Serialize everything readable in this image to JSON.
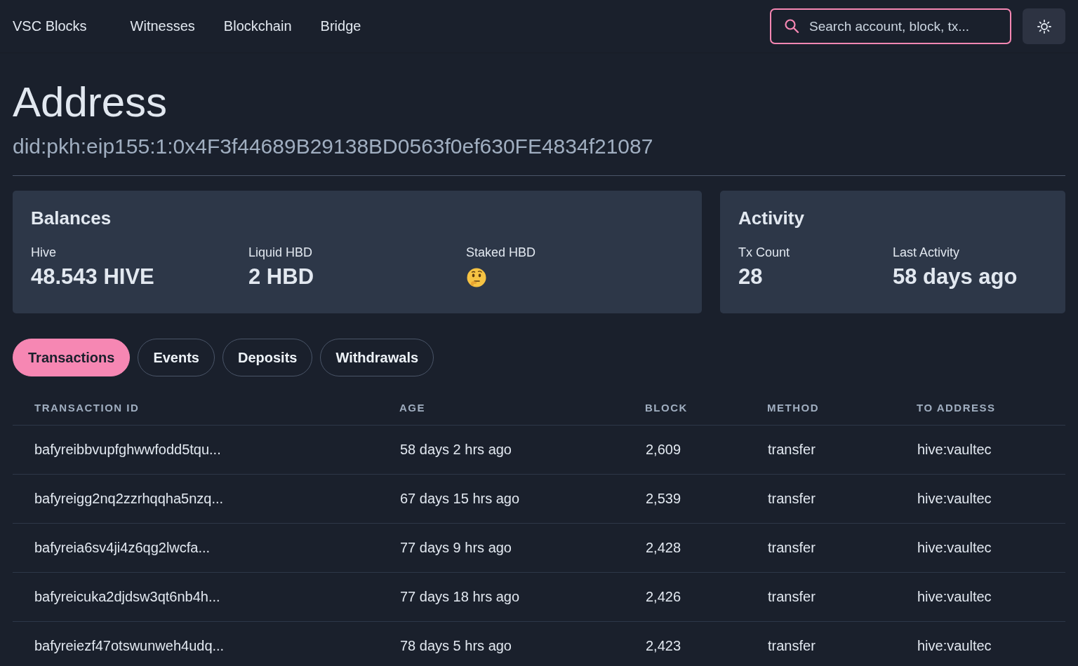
{
  "nav": {
    "brand": "VSC Blocks",
    "links": [
      "Witnesses",
      "Blockchain",
      "Bridge"
    ],
    "search": {
      "placeholder": "Search account, block, tx..."
    }
  },
  "page": {
    "title": "Address",
    "address": "did:pkh:eip155:1:0x4F3f44689B29138BD0563f0ef630FE4834f21087"
  },
  "balances": {
    "title": "Balances",
    "items": [
      {
        "label": "Hive",
        "kind": "value",
        "value": "48.543 HIVE"
      },
      {
        "label": "Liquid HBD",
        "kind": "value",
        "value": "2 HBD"
      },
      {
        "label": "Staked HBD",
        "kind": "unknown"
      }
    ]
  },
  "activity": {
    "title": "Activity",
    "items": [
      {
        "label": "Tx Count",
        "value": "28"
      },
      {
        "label": "Last Activity",
        "value": "58 days ago"
      }
    ]
  },
  "tabs": [
    {
      "label": "Transactions",
      "selected": true
    },
    {
      "label": "Events",
      "selected": false
    },
    {
      "label": "Deposits",
      "selected": false
    },
    {
      "label": "Withdrawals",
      "selected": false
    }
  ],
  "table": {
    "columns": [
      "TRANSACTION ID",
      "AGE",
      "BLOCK",
      "METHOD",
      "TO ADDRESS"
    ],
    "rows": [
      [
        "bafyreibbvupfghwwfodd5tqu...",
        "58 days 2 hrs ago",
        "2,609",
        "transfer",
        "hive:vaultec"
      ],
      [
        "bafyreigg2nq2zzrhqqha5nzq...",
        "67 days 15 hrs ago",
        "2,539",
        "transfer",
        "hive:vaultec"
      ],
      [
        "bafyreia6sv4ji4z6qg2lwcfa...",
        "77 days 9 hrs ago",
        "2,428",
        "transfer",
        "hive:vaultec"
      ],
      [
        "bafyreicuka2djdsw3qt6nb4h...",
        "77 days 18 hrs ago",
        "2,426",
        "transfer",
        "hive:vaultec"
      ],
      [
        "bafyreiezf47otswunweh4udq...",
        "78 days 5 hrs ago",
        "2,423",
        "transfer",
        "hive:vaultec"
      ]
    ]
  }
}
